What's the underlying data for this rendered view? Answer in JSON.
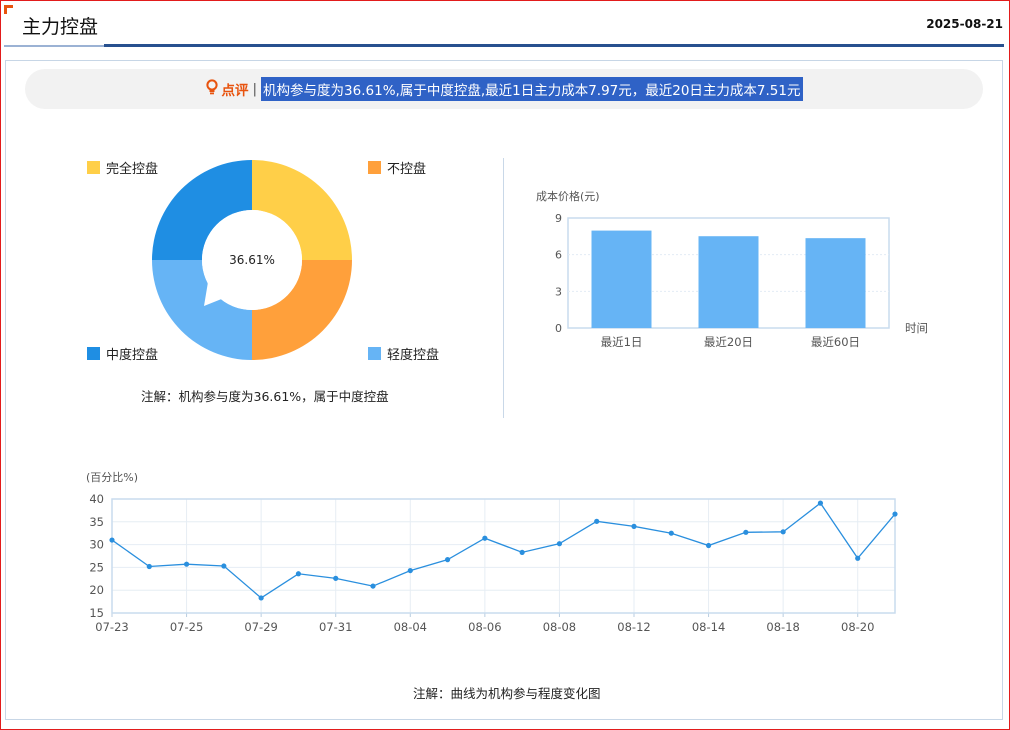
{
  "header": {
    "title": "主力控盘",
    "date": "2025-08-21"
  },
  "comment": {
    "icon": "lightbulb-icon",
    "label": "点评",
    "separator": "|",
    "text": "机构参与度为36.61%,属于中度控盘,最近1日主力成本7.97元，最近20日主力成本7.51元"
  },
  "pie": {
    "center_label": "36.61%",
    "legend": [
      {
        "label": "完全控盘",
        "color": "#ffcf48"
      },
      {
        "label": "不控盘",
        "color": "#ffa03b"
      },
      {
        "label": "中度控盘",
        "color": "#1f8ee3"
      },
      {
        "label": "轻度控盘",
        "color": "#66b4f5"
      }
    ],
    "note": "注解：机构参与度为36.61%，属于中度控盘"
  },
  "bar": {
    "ylabel": "成本价格(元)",
    "xlabel": "时间",
    "color": "#66b4f5"
  },
  "line": {
    "ylabel": "(百分比%)",
    "color": "#2a8fde",
    "note": "注解：曲线为机构参与程度变化图"
  },
  "chart_data": [
    {
      "type": "pie",
      "title": "",
      "categories": [
        "完全控盘",
        "不控盘",
        "轻度控盘",
        "中度控盘"
      ],
      "values": [
        25,
        25,
        25,
        25
      ],
      "center_label": "36.61%"
    },
    {
      "type": "bar",
      "categories": [
        "最近1日",
        "最近20日",
        "最近60日"
      ],
      "values": [
        7.97,
        7.51,
        7.35
      ],
      "ylabel": "成本价格(元)",
      "xlabel": "时间",
      "ylim": [
        0,
        9
      ],
      "yticks": [
        0,
        3,
        6,
        9
      ],
      "grid": true
    },
    {
      "type": "line",
      "ylabel": "(百分比%)",
      "ylim": [
        15,
        40
      ],
      "yticks": [
        15,
        20,
        25,
        30,
        35,
        40
      ],
      "x": [
        "07-23",
        "07-24",
        "07-25",
        "07-28",
        "07-29",
        "07-30",
        "07-31",
        "08-01",
        "08-04",
        "08-05",
        "08-06",
        "08-07",
        "08-08",
        "08-11",
        "08-12",
        "08-13",
        "08-14",
        "08-15",
        "08-18",
        "08-19",
        "08-20",
        "08-21"
      ],
      "xtick_labels": [
        "07-23",
        "07-25",
        "07-29",
        "07-31",
        "08-04",
        "08-06",
        "08-08",
        "08-12",
        "08-14",
        "08-18",
        "08-20"
      ],
      "values": [
        31.0,
        25.2,
        25.7,
        25.3,
        18.3,
        23.6,
        22.6,
        20.9,
        24.3,
        26.7,
        31.4,
        28.3,
        30.2,
        35.1,
        34.0,
        32.5,
        29.8,
        32.7,
        32.8,
        39.1,
        27.0,
        36.7
      ],
      "grid": true
    }
  ]
}
